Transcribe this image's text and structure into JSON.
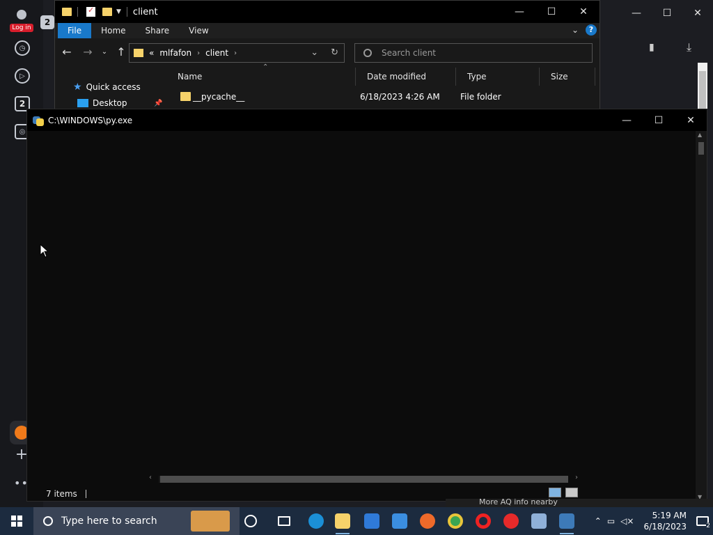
{
  "browser": {
    "login_label": "Log in",
    "tab_count": "2",
    "sidebar_badge": "2"
  },
  "explorer": {
    "title": "client",
    "ribbon_tabs": [
      "File",
      "Home",
      "Share",
      "View"
    ],
    "help_label": "?",
    "address": {
      "overflow": "«",
      "crumbs": [
        "mlfafon",
        "client"
      ]
    },
    "search_placeholder": "Search client",
    "nav_pane": {
      "quick_access": "Quick access",
      "desktop": "Desktop"
    },
    "columns": [
      "Name",
      "Date modified",
      "Type",
      "Size"
    ],
    "rows": [
      {
        "name": "__pycache__",
        "date": "6/18/2023 4:26 AM",
        "type": "File folder"
      }
    ],
    "status_items": "7 items"
  },
  "console": {
    "title": "C:\\WINDOWS\\py.exe"
  },
  "background_text": {
    "aq_info": "More AQ info nearby"
  },
  "taskbar": {
    "search_placeholder": "Type here to search",
    "clock_time": "5:19 AM",
    "clock_date": "6/18/2023",
    "notification_count": "2",
    "pinned_apps": [
      "task-view",
      "cortana",
      "edge",
      "file-explorer",
      "store",
      "mail",
      "firefox",
      "chrome",
      "opera",
      "yandex",
      "network-app",
      "python"
    ]
  },
  "colors": {
    "accent": "#1979ca",
    "folder": "#f6d26a",
    "taskbar": "#1c2b3f",
    "console_bg": "#0c0c0c"
  }
}
